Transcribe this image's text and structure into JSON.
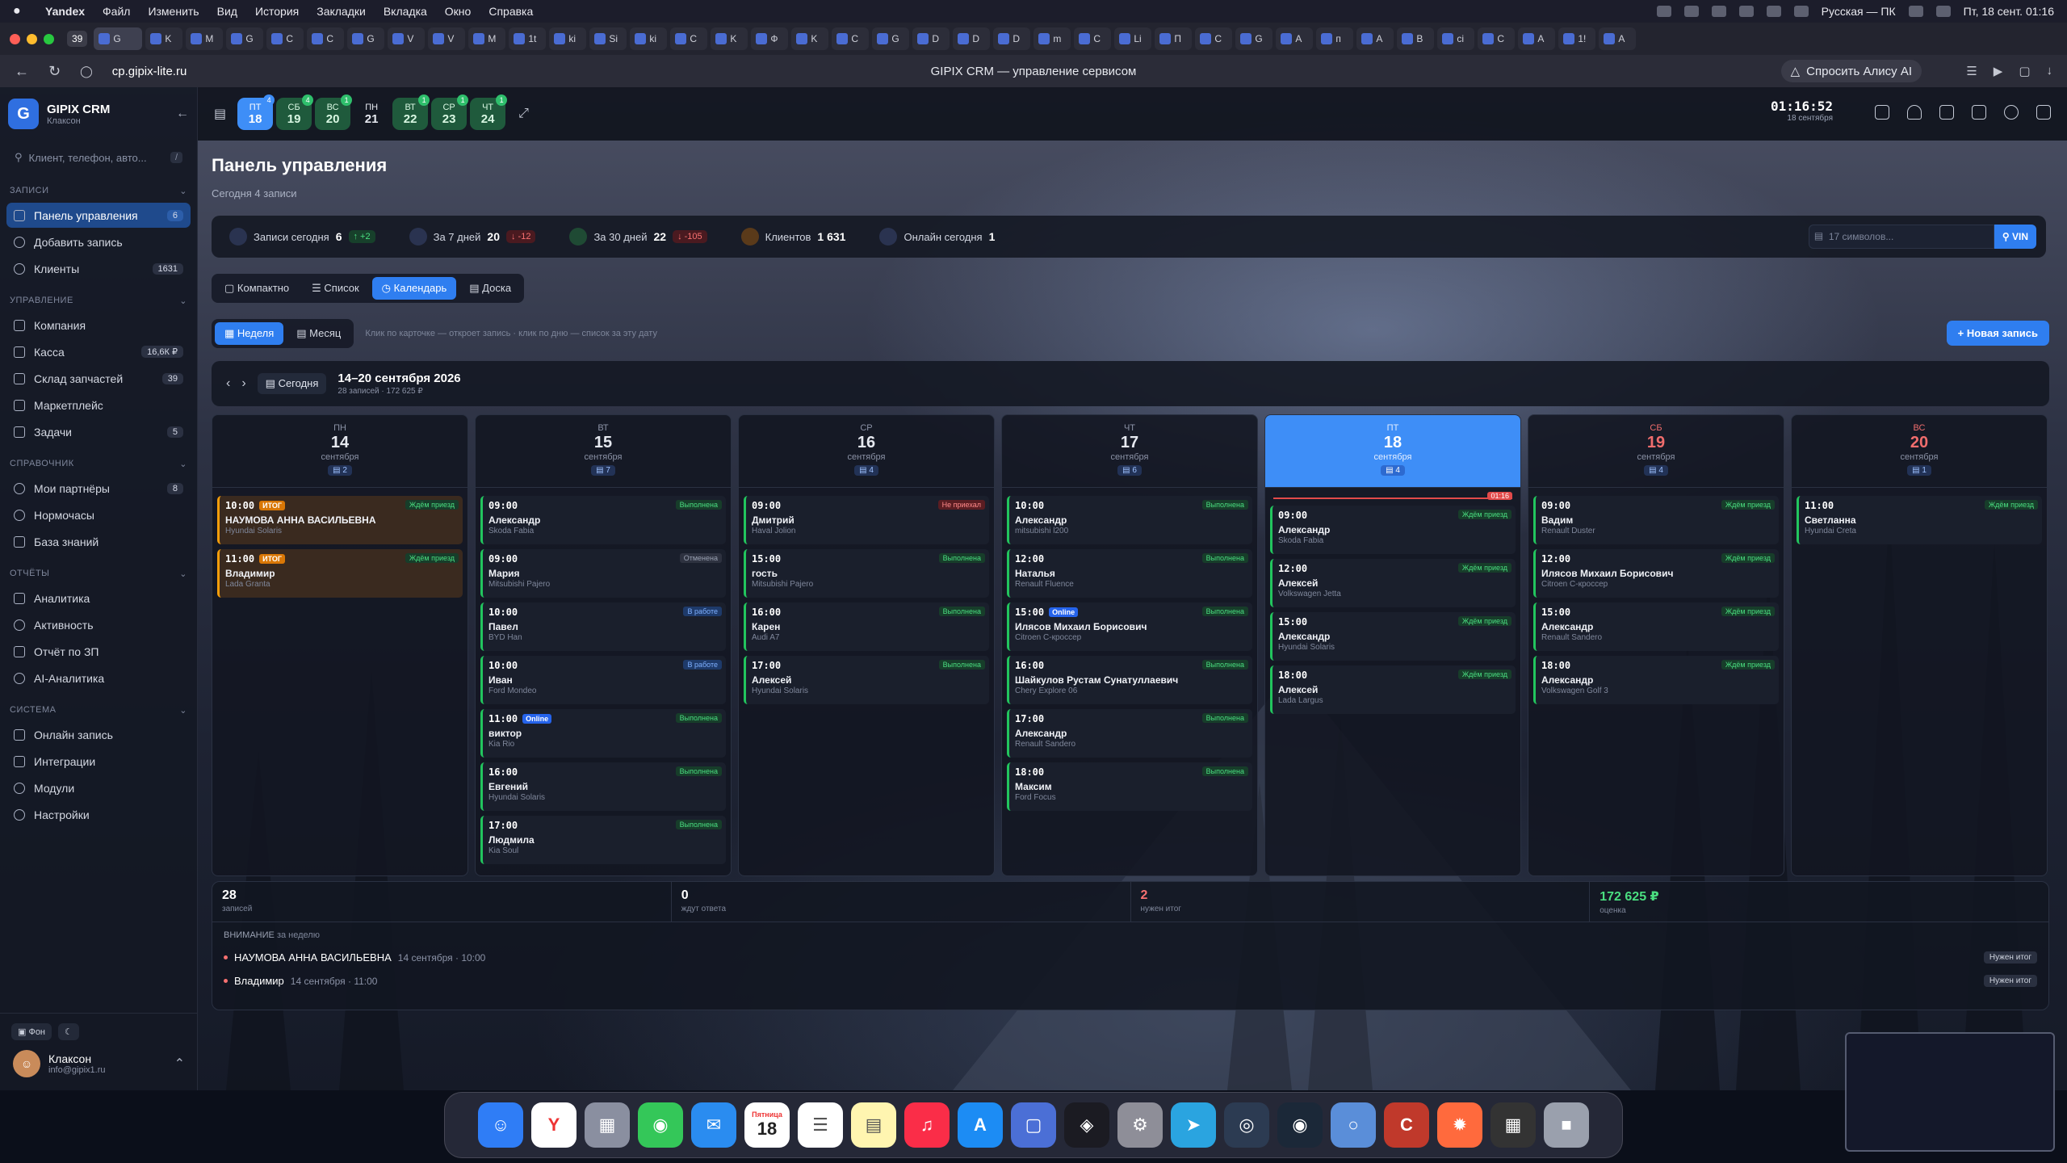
{
  "menubar": {
    "app": "Yandex",
    "items": [
      "Файл",
      "Изменить",
      "Вид",
      "История",
      "Закладки",
      "Вкладка",
      "Окно",
      "Справка"
    ],
    "keyboard": "Русская — ПК",
    "datetime": "Пт, 18 сент. 01:16"
  },
  "browser": {
    "tab_count": "39",
    "tabs": [
      "K",
      "M",
      "G",
      "C",
      "C",
      "G",
      "V",
      "V",
      "M",
      "1t",
      "ki",
      "Si",
      "ki",
      "C",
      "K",
      "Ф",
      "K",
      "C",
      "G",
      "D",
      "D",
      "D",
      "m",
      "C",
      "Li",
      "П",
      "C",
      "G",
      "A",
      "п",
      "A",
      "B",
      "ci",
      "C",
      "A",
      "1!",
      "A"
    ],
    "active_tab": "G",
    "url": "cp.gipix-lite.ru",
    "page_title": "GIPIX CRM — управление сервисом",
    "alisa": "Спросить Алису AI"
  },
  "sidebar": {
    "brand": "GIPIX CRM",
    "brand_sub": "Клаксон",
    "search_placeholder": "Клиент, телефон, авто...",
    "search_kbd": "/",
    "sections": {
      "records": "ЗАПИСИ",
      "management": "УПРАВЛЕНИЕ",
      "reference": "СПРАВОЧНИК",
      "reports": "ОТЧЁТЫ",
      "system": "СИСТЕМА"
    },
    "items": {
      "dashboard": {
        "label": "Панель управления",
        "badge": "6"
      },
      "add": {
        "label": "Добавить запись"
      },
      "clients": {
        "label": "Клиенты",
        "badge": "1631"
      },
      "company": {
        "label": "Компания"
      },
      "cash": {
        "label": "Касса",
        "badge": "16,6К ₽"
      },
      "warehouse": {
        "label": "Склад запчастей",
        "badge": "39"
      },
      "marketplace": {
        "label": "Маркетплейс"
      },
      "tasks": {
        "label": "Задачи",
        "badge": "5"
      },
      "partners": {
        "label": "Мои партнёры",
        "badge": "8"
      },
      "norms": {
        "label": "Нормочасы"
      },
      "kb": {
        "label": "База знаний"
      },
      "analytics": {
        "label": "Аналитика"
      },
      "activity": {
        "label": "Активность"
      },
      "payroll": {
        "label": "Отчёт по ЗП"
      },
      "ai": {
        "label": "AI-Аналитика"
      },
      "online": {
        "label": "Онлайн запись"
      },
      "integrations": {
        "label": "Интеграции"
      },
      "modules": {
        "label": "Модули"
      },
      "settings": {
        "label": "Настройки"
      }
    },
    "bg_label": "Фон",
    "user_name": "Клаксон",
    "user_email": "info@gipix1.ru"
  },
  "topstrip": {
    "days": [
      {
        "d": "ПТ",
        "n": "18",
        "badge": "4",
        "kind": "today"
      },
      {
        "d": "СБ",
        "n": "19",
        "badge": "4",
        "kind": "green"
      },
      {
        "d": "ВС",
        "n": "20",
        "badge": "1",
        "kind": "green"
      },
      {
        "d": "ПН",
        "n": "21",
        "badge": "",
        "kind": "plain"
      },
      {
        "d": "ВТ",
        "n": "22",
        "badge": "1",
        "kind": "green"
      },
      {
        "d": "СР",
        "n": "23",
        "badge": "1",
        "kind": "green"
      },
      {
        "d": "ЧТ",
        "n": "24",
        "badge": "1",
        "kind": "green"
      }
    ],
    "time": "01:16:52",
    "date": "18 сентября"
  },
  "main": {
    "title": "Панель управления",
    "subtitle": "Сегодня 4 записи",
    "stats": {
      "today": {
        "label": "Записи сегодня",
        "value": "6",
        "delta": "↑ +2"
      },
      "week": {
        "label": "За 7 дней",
        "value": "20",
        "delta": "↓ -12"
      },
      "month": {
        "label": "За 30 дней",
        "value": "22",
        "delta": "↓ -105"
      },
      "clients": {
        "label": "Клиентов",
        "value": "1 631"
      },
      "online": {
        "label": "Онлайн сегодня",
        "value": "1"
      }
    },
    "vin_placeholder": "17 символов...",
    "vin_button": "VIN",
    "view_tabs": [
      "Компактно",
      "Список",
      "Календарь",
      "Доска"
    ],
    "range_tabs": [
      "Неделя",
      "Месяц"
    ],
    "hint": "Клик по карточке — откроет запись · клик по дню — список за эту дату",
    "new_button": "+ Новая запись",
    "today_button": "Сегодня",
    "week_range": "14–20 сентября 2026",
    "week_meta": "28 записей · 172 625 ₽"
  },
  "calendar": {
    "now_tag": "01:16",
    "days": [
      {
        "dn": "ПН",
        "dd": "14",
        "dm": "сентября",
        "count": "2",
        "cls": "",
        "cards": [
          {
            "t": "10:00",
            "tag": "ИТОГ",
            "name": "НАУМОВА АННА ВАСИЛЬЕВНА",
            "car": "Hyundai Solaris",
            "status": "Ждём приезд",
            "s": "s-wait",
            "orange": true
          },
          {
            "t": "11:00",
            "tag": "ИТОГ",
            "name": "Владимир",
            "car": "Lada Granta",
            "status": "Ждём приезд",
            "s": "s-wait",
            "orange": true
          }
        ]
      },
      {
        "dn": "ВТ",
        "dd": "15",
        "dm": "сентября",
        "count": "7",
        "cls": "",
        "cards": [
          {
            "t": "09:00",
            "name": "Александр",
            "car": "Skoda Fabia",
            "status": "Выполнена",
            "s": "s-done"
          },
          {
            "t": "09:00",
            "name": "Мария",
            "car": "Mitsubishi Pajero",
            "status": "Отменена",
            "s": "s-cancel"
          },
          {
            "t": "10:00",
            "name": "Павел",
            "car": "BYD Han",
            "status": "В работе",
            "s": "s-work"
          },
          {
            "t": "10:00",
            "name": "Иван",
            "car": "Ford Mondeo",
            "status": "В работе",
            "s": "s-work"
          },
          {
            "t": "11:00",
            "tag": "Online",
            "name": "виктор",
            "car": "Kia Rio",
            "status": "Выполнена",
            "s": "s-done"
          },
          {
            "t": "16:00",
            "name": "Евгений",
            "car": "Hyundai Solaris",
            "status": "Выполнена",
            "s": "s-done"
          },
          {
            "t": "17:00",
            "name": "Людмила",
            "car": "Kia Soul",
            "status": "Выполнена",
            "s": "s-done"
          }
        ]
      },
      {
        "dn": "СР",
        "dd": "16",
        "dm": "сентября",
        "count": "4",
        "cls": "",
        "cards": [
          {
            "t": "09:00",
            "name": "Дмитрий",
            "car": "Haval Jolion",
            "status": "Не приехал",
            "s": "s-noshow"
          },
          {
            "t": "15:00",
            "name": "гость",
            "car": "Mitsubishi Pajero",
            "status": "Выполнена",
            "s": "s-done"
          },
          {
            "t": "16:00",
            "name": "Карен",
            "car": "Audi A7",
            "status": "Выполнена",
            "s": "s-done"
          },
          {
            "t": "17:00",
            "name": "Алексей",
            "car": "Hyundai Solaris",
            "status": "Выполнена",
            "s": "s-done"
          }
        ]
      },
      {
        "dn": "ЧТ",
        "dd": "17",
        "dm": "сентября",
        "count": "6",
        "cls": "",
        "cards": [
          {
            "t": "10:00",
            "name": "Александр",
            "car": "mitsubishi l200",
            "status": "Выполнена",
            "s": "s-done"
          },
          {
            "t": "12:00",
            "name": "Наталья",
            "car": "Renault Fluence",
            "status": "Выполнена",
            "s": "s-done"
          },
          {
            "t": "15:00",
            "tag": "Online",
            "name": "Илясов Михаил Борисович",
            "car": "Citroen C-кроссер",
            "status": "Выполнена",
            "s": "s-done"
          },
          {
            "t": "16:00",
            "name": "Шайкулов Рустам Сунатуллаевич",
            "car": "Chery Explore 06",
            "status": "Выполнена",
            "s": "s-done"
          },
          {
            "t": "17:00",
            "name": "Александр",
            "car": "Renault Sandero",
            "status": "Выполнена",
            "s": "s-done"
          },
          {
            "t": "18:00",
            "name": "Максим",
            "car": "Ford Focus",
            "status": "Выполнена",
            "s": "s-done"
          }
        ]
      },
      {
        "dn": "ПТ",
        "dd": "18",
        "dm": "сентября",
        "count": "4",
        "cls": "today",
        "cards": [
          {
            "t": "09:00",
            "name": "Александр",
            "car": "Skoda Fabia",
            "status": "Ждём приезд",
            "s": "s-wait"
          },
          {
            "t": "12:00",
            "name": "Алексей",
            "car": "Volkswagen Jetta",
            "status": "Ждём приезд",
            "s": "s-wait"
          },
          {
            "t": "15:00",
            "name": "Александр",
            "car": "Hyundai Solaris",
            "status": "Ждём приезд",
            "s": "s-wait"
          },
          {
            "t": "18:00",
            "name": "Алексей",
            "car": "Lada Largus",
            "status": "Ждём приезд",
            "s": "s-wait"
          }
        ]
      },
      {
        "dn": "СБ",
        "dd": "19",
        "dm": "сентября",
        "count": "4",
        "cls": "weekend",
        "cards": [
          {
            "t": "09:00",
            "name": "Вадим",
            "car": "Renault Duster",
            "status": "Ждём приезд",
            "s": "s-wait"
          },
          {
            "t": "12:00",
            "name": "Илясов Михаил Борисович",
            "car": "Citroen C-кроссер",
            "status": "Ждём приезд",
            "s": "s-wait"
          },
          {
            "t": "15:00",
            "name": "Александр",
            "car": "Renault Sandero",
            "status": "Ждём приезд",
            "s": "s-wait"
          },
          {
            "t": "18:00",
            "name": "Александр",
            "car": "Volkswagen Golf 3",
            "status": "Ждём приезд",
            "s": "s-wait"
          }
        ]
      },
      {
        "dn": "ВС",
        "dd": "20",
        "dm": "сентября",
        "count": "1",
        "cls": "weekend",
        "cards": [
          {
            "t": "11:00",
            "name": "Светланна",
            "car": "Hyundai Creta",
            "status": "Ждём приезд",
            "s": "s-wait"
          }
        ]
      }
    ]
  },
  "summary": {
    "cells": [
      {
        "v": "28",
        "l": "записей",
        "cls": ""
      },
      {
        "v": "0",
        "l": "ждут ответа",
        "cls": ""
      },
      {
        "v": "2",
        "l": "нужен итог",
        "cls": "red"
      },
      {
        "v": "172 625 ₽",
        "l": "оценка",
        "cls": "green"
      }
    ],
    "attention_title": "ВНИМАНИЕ",
    "attention_sub": "за неделю",
    "attention": [
      {
        "name": "НАУМОВА АННА ВАСИЛЬЕВНА",
        "meta": "14 сентября · 10:00",
        "badge": "Нужен итог"
      },
      {
        "name": "Владимир",
        "meta": "14 сентября · 11:00",
        "badge": "Нужен итог"
      }
    ]
  },
  "dock": {
    "calendar_day": "Пятница",
    "calendar_num": "18"
  }
}
